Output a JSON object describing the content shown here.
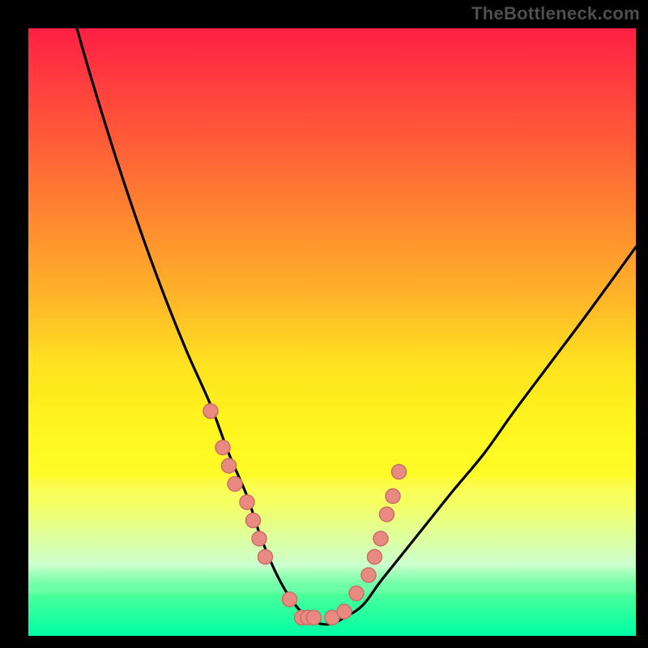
{
  "watermark": "TheBottleneck.com",
  "chart_data": {
    "type": "line",
    "title": "",
    "xlabel": "",
    "ylabel": "",
    "xlim": [
      0,
      100
    ],
    "ylim": [
      0,
      100
    ],
    "grid": false,
    "series": [
      {
        "name": "bottleneck-curve",
        "x": [
          8,
          10,
          14,
          18,
          22,
          26,
          30,
          33,
          36,
          38,
          40,
          42,
          44,
          46,
          48,
          50,
          52,
          55,
          58,
          62,
          66,
          70,
          75,
          80,
          86,
          92,
          100
        ],
        "y": [
          100,
          93,
          80,
          68,
          57,
          47,
          38,
          30,
          23,
          17,
          12,
          8,
          5,
          3,
          2,
          2,
          3,
          5,
          9,
          14,
          19,
          24,
          30,
          37,
          45,
          53,
          64
        ]
      }
    ],
    "points": {
      "name": "sample-markers",
      "x": [
        30,
        32,
        33,
        34,
        36,
        37,
        38,
        39,
        43,
        45,
        46,
        47,
        50,
        52,
        54,
        56,
        57,
        58,
        59,
        60,
        61
      ],
      "y": [
        37,
        31,
        28,
        25,
        22,
        19,
        16,
        13,
        6,
        3,
        3,
        3,
        3,
        4,
        7,
        10,
        13,
        16,
        20,
        23,
        27
      ]
    },
    "background_gradient": {
      "stops": [
        {
          "pos": 0.0,
          "color": "#ff1f44"
        },
        {
          "pos": 0.18,
          "color": "#ff5a38"
        },
        {
          "pos": 0.45,
          "color": "#ffb728"
        },
        {
          "pos": 0.65,
          "color": "#fff51d"
        },
        {
          "pos": 0.88,
          "color": "#ccffca"
        },
        {
          "pos": 1.0,
          "color": "#00ffa6"
        }
      ]
    }
  }
}
